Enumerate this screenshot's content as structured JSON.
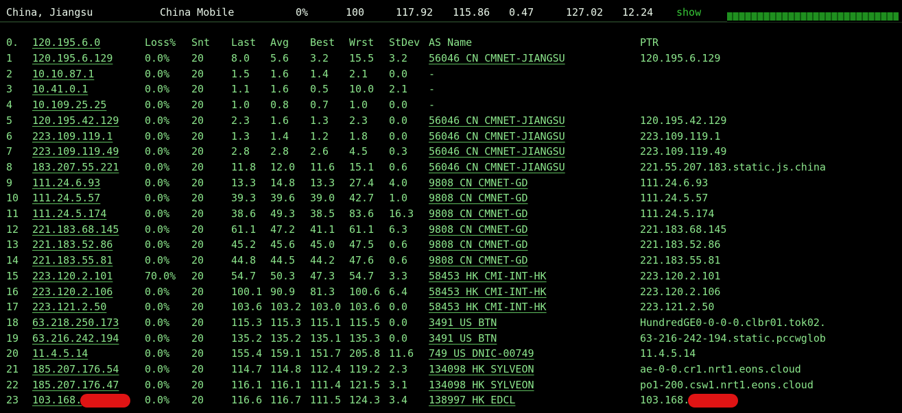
{
  "summary": {
    "location": "China, Jiangsu",
    "isp": "China Mobile",
    "loss": "0%",
    "sent": "100",
    "last": "117.92",
    "avg": "115.86",
    "best": "0.47",
    "worst": "127.02",
    "stdev": "12.24",
    "show_label": "show",
    "progress_fraction": 0.98
  },
  "colors": {
    "text_green": "#8be58b",
    "redaction": "#e01414",
    "show_link": "#36c636",
    "background": "#000000"
  },
  "table": {
    "headers": [
      "0.",
      "120.195.6.0",
      "Loss%",
      "Snt",
      "Last",
      "Avg",
      "Best",
      "Wrst",
      "StDev",
      "AS Name",
      "PTR"
    ],
    "rows": [
      {
        "hop": "1",
        "host": "120.195.6.129",
        "loss": "0.0%",
        "snt": "20",
        "last": "8.0",
        "avg": "5.6",
        "best": "3.2",
        "wrst": "15.5",
        "stdev": "3.2",
        "as": "56046 CN CMNET-JIANGSU",
        "ptr": "120.195.6.129"
      },
      {
        "hop": "2",
        "host": "10.10.87.1",
        "loss": "0.0%",
        "snt": "20",
        "last": "1.5",
        "avg": "1.6",
        "best": "1.4",
        "wrst": "2.1",
        "stdev": "0.0",
        "as": "-",
        "ptr": ""
      },
      {
        "hop": "3",
        "host": "10.41.0.1",
        "loss": "0.0%",
        "snt": "20",
        "last": "1.1",
        "avg": "1.6",
        "best": "0.5",
        "wrst": "10.0",
        "stdev": "2.1",
        "as": "-",
        "ptr": ""
      },
      {
        "hop": "4",
        "host": "10.109.25.25",
        "loss": "0.0%",
        "snt": "20",
        "last": "1.0",
        "avg": "0.8",
        "best": "0.7",
        "wrst": "1.0",
        "stdev": "0.0",
        "as": "-",
        "ptr": ""
      },
      {
        "hop": "5",
        "host": "120.195.42.129",
        "loss": "0.0%",
        "snt": "20",
        "last": "2.3",
        "avg": "1.6",
        "best": "1.3",
        "wrst": "2.3",
        "stdev": "0.0",
        "as": "56046 CN CMNET-JIANGSU",
        "ptr": "120.195.42.129"
      },
      {
        "hop": "6",
        "host": "223.109.119.1",
        "loss": "0.0%",
        "snt": "20",
        "last": "1.3",
        "avg": "1.4",
        "best": "1.2",
        "wrst": "1.8",
        "stdev": "0.0",
        "as": "56046 CN CMNET-JIANGSU",
        "ptr": "223.109.119.1"
      },
      {
        "hop": "7",
        "host": "223.109.119.49",
        "loss": "0.0%",
        "snt": "20",
        "last": "2.8",
        "avg": "2.8",
        "best": "2.6",
        "wrst": "4.5",
        "stdev": "0.3",
        "as": "56046 CN CMNET-JIANGSU",
        "ptr": "223.109.119.49"
      },
      {
        "hop": "8",
        "host": "183.207.55.221",
        "loss": "0.0%",
        "snt": "20",
        "last": "11.8",
        "avg": "12.0",
        "best": "11.6",
        "wrst": "15.1",
        "stdev": "0.6",
        "as": "56046 CN CMNET-JIANGSU",
        "ptr": "221.55.207.183.static.js.china"
      },
      {
        "hop": "9",
        "host": "111.24.6.93",
        "loss": "0.0%",
        "snt": "20",
        "last": "13.3",
        "avg": "14.8",
        "best": "13.3",
        "wrst": "27.4",
        "stdev": "4.0",
        "as": "9808  CN CMNET-GD",
        "ptr": "111.24.6.93"
      },
      {
        "hop": "10",
        "host": "111.24.5.57",
        "loss": "0.0%",
        "snt": "20",
        "last": "39.3",
        "avg": "39.6",
        "best": "39.0",
        "wrst": "42.7",
        "stdev": "1.0",
        "as": "9808  CN CMNET-GD",
        "ptr": "111.24.5.57"
      },
      {
        "hop": "11",
        "host": "111.24.5.174",
        "loss": "0.0%",
        "snt": "20",
        "last": "38.6",
        "avg": "49.3",
        "best": "38.5",
        "wrst": "83.6",
        "stdev": "16.3",
        "as": "9808  CN CMNET-GD",
        "ptr": "111.24.5.174"
      },
      {
        "hop": "12",
        "host": "221.183.68.145",
        "loss": "0.0%",
        "snt": "20",
        "last": "61.1",
        "avg": "47.2",
        "best": "41.1",
        "wrst": "61.1",
        "stdev": "6.3",
        "as": "9808  CN CMNET-GD",
        "ptr": "221.183.68.145"
      },
      {
        "hop": "13",
        "host": "221.183.52.86",
        "loss": "0.0%",
        "snt": "20",
        "last": "45.2",
        "avg": "45.6",
        "best": "45.0",
        "wrst": "47.5",
        "stdev": "0.6",
        "as": "9808  CN CMNET-GD",
        "ptr": "221.183.52.86"
      },
      {
        "hop": "14",
        "host": "221.183.55.81",
        "loss": "0.0%",
        "snt": "20",
        "last": "44.8",
        "avg": "44.5",
        "best": "44.2",
        "wrst": "47.6",
        "stdev": "0.6",
        "as": "9808  CN CMNET-GD",
        "ptr": "221.183.55.81"
      },
      {
        "hop": "15",
        "host": "223.120.2.101",
        "loss": "70.0%",
        "snt": "20",
        "last": "54.7",
        "avg": "50.3",
        "best": "47.3",
        "wrst": "54.7",
        "stdev": "3.3",
        "as": "58453 HK CMI-INT-HK",
        "ptr": "223.120.2.101"
      },
      {
        "hop": "16",
        "host": "223.120.2.106",
        "loss": "0.0%",
        "snt": "20",
        "last": "100.1",
        "avg": "90.9",
        "best": "81.3",
        "wrst": "100.6",
        "stdev": "6.4",
        "as": "58453 HK CMI-INT-HK",
        "ptr": "223.120.2.106"
      },
      {
        "hop": "17",
        "host": "223.121.2.50",
        "loss": "0.0%",
        "snt": "20",
        "last": "103.6",
        "avg": "103.2",
        "best": "103.0",
        "wrst": "103.6",
        "stdev": "0.0",
        "as": "58453 HK CMI-INT-HK",
        "ptr": "223.121.2.50"
      },
      {
        "hop": "18",
        "host": "63.218.250.173",
        "loss": "0.0%",
        "snt": "20",
        "last": "115.3",
        "avg": "115.3",
        "best": "115.1",
        "wrst": "115.5",
        "stdev": "0.0",
        "as": "3491  US BTN",
        "ptr": "HundredGE0-0-0-0.clbr01.tok02."
      },
      {
        "hop": "19",
        "host": "63.216.242.194",
        "loss": "0.0%",
        "snt": "20",
        "last": "135.2",
        "avg": "135.2",
        "best": "135.1",
        "wrst": "135.3",
        "stdev": "0.0",
        "as": "3491  US BTN",
        "ptr": "63-216-242-194.static.pccwglob"
      },
      {
        "hop": "20",
        "host": "11.4.5.14",
        "loss": "0.0%",
        "snt": "20",
        "last": "155.4",
        "avg": "159.1",
        "best": "151.7",
        "wrst": "205.8",
        "stdev": "11.6",
        "as": "749   US DNIC-00749",
        "ptr": "11.4.5.14"
      },
      {
        "hop": "21",
        "host": "185.207.176.54",
        "loss": "0.0%",
        "snt": "20",
        "last": "114.7",
        "avg": "114.8",
        "best": "112.4",
        "wrst": "119.2",
        "stdev": "2.3",
        "as": "134098 HK SYLVEON",
        "ptr": "ae-0-0.cr1.nrt1.eons.cloud"
      },
      {
        "hop": "22",
        "host": "185.207.176.47",
        "loss": "0.0%",
        "snt": "20",
        "last": "116.1",
        "avg": "116.1",
        "best": "111.4",
        "wrst": "121.5",
        "stdev": "3.1",
        "as": "134098 HK SYLVEON",
        "ptr": "po1-200.csw1.nrt1.eons.cloud"
      },
      {
        "hop": "23",
        "host": "103.168.",
        "loss": "0.0%",
        "snt": "20",
        "last": "116.6",
        "avg": "116.7",
        "best": "111.5",
        "wrst": "124.3",
        "stdev": "3.4",
        "as": "138997 HK EDCL",
        "ptr": "103.168.",
        "redacted": true
      }
    ]
  }
}
